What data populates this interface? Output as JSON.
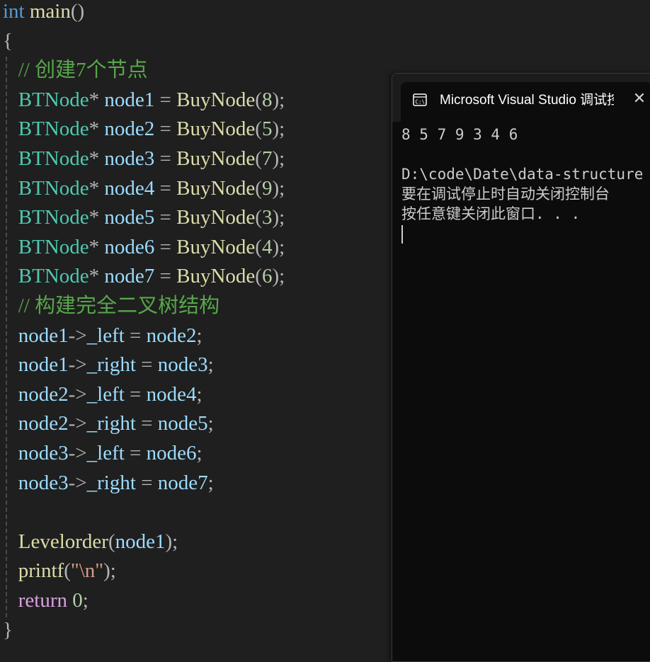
{
  "editor": {
    "lines": [
      [
        {
          "t": "int",
          "c": "kw"
        },
        {
          "t": " main",
          "c": "fn"
        },
        {
          "t": "()",
          "c": "pn"
        }
      ],
      [
        {
          "t": "{",
          "c": "pn"
        }
      ],
      [
        {
          "t": "   // 创建7个节点",
          "c": "cm"
        }
      ],
      [
        {
          "t": "   BTNode",
          "c": "type"
        },
        {
          "t": "* ",
          "c": "pn"
        },
        {
          "t": "node1",
          "c": "var"
        },
        {
          "t": " = ",
          "c": "pn"
        },
        {
          "t": "BuyNode",
          "c": "fn"
        },
        {
          "t": "(",
          "c": "pn"
        },
        {
          "t": "8",
          "c": "num"
        },
        {
          "t": ");",
          "c": "pn"
        }
      ],
      [
        {
          "t": "   BTNode",
          "c": "type"
        },
        {
          "t": "* ",
          "c": "pn"
        },
        {
          "t": "node2",
          "c": "var"
        },
        {
          "t": " = ",
          "c": "pn"
        },
        {
          "t": "BuyNode",
          "c": "fn"
        },
        {
          "t": "(",
          "c": "pn"
        },
        {
          "t": "5",
          "c": "num"
        },
        {
          "t": ");",
          "c": "pn"
        }
      ],
      [
        {
          "t": "   BTNode",
          "c": "type"
        },
        {
          "t": "* ",
          "c": "pn"
        },
        {
          "t": "node3",
          "c": "var"
        },
        {
          "t": " = ",
          "c": "pn"
        },
        {
          "t": "BuyNode",
          "c": "fn"
        },
        {
          "t": "(",
          "c": "pn"
        },
        {
          "t": "7",
          "c": "num"
        },
        {
          "t": ");",
          "c": "pn"
        }
      ],
      [
        {
          "t": "   BTNode",
          "c": "type"
        },
        {
          "t": "* ",
          "c": "pn"
        },
        {
          "t": "node4",
          "c": "var"
        },
        {
          "t": " = ",
          "c": "pn"
        },
        {
          "t": "BuyNode",
          "c": "fn"
        },
        {
          "t": "(",
          "c": "pn"
        },
        {
          "t": "9",
          "c": "num"
        },
        {
          "t": ");",
          "c": "pn"
        }
      ],
      [
        {
          "t": "   BTNode",
          "c": "type"
        },
        {
          "t": "* ",
          "c": "pn"
        },
        {
          "t": "node5",
          "c": "var"
        },
        {
          "t": " = ",
          "c": "pn"
        },
        {
          "t": "BuyNode",
          "c": "fn"
        },
        {
          "t": "(",
          "c": "pn"
        },
        {
          "t": "3",
          "c": "num"
        },
        {
          "t": ");",
          "c": "pn"
        }
      ],
      [
        {
          "t": "   BTNode",
          "c": "type"
        },
        {
          "t": "* ",
          "c": "pn"
        },
        {
          "t": "node6",
          "c": "var"
        },
        {
          "t": " = ",
          "c": "pn"
        },
        {
          "t": "BuyNode",
          "c": "fn"
        },
        {
          "t": "(",
          "c": "pn"
        },
        {
          "t": "4",
          "c": "num"
        },
        {
          "t": ");",
          "c": "pn"
        }
      ],
      [
        {
          "t": "   BTNode",
          "c": "type"
        },
        {
          "t": "* ",
          "c": "pn"
        },
        {
          "t": "node7",
          "c": "var"
        },
        {
          "t": " = ",
          "c": "pn"
        },
        {
          "t": "BuyNode",
          "c": "fn"
        },
        {
          "t": "(",
          "c": "pn"
        },
        {
          "t": "6",
          "c": "num"
        },
        {
          "t": ");",
          "c": "pn"
        }
      ],
      [
        {
          "t": "   // 构建完全二叉树结构",
          "c": "cm"
        }
      ],
      [
        {
          "t": "   node1",
          "c": "var"
        },
        {
          "t": "->",
          "c": "pn"
        },
        {
          "t": "_left",
          "c": "var"
        },
        {
          "t": " = ",
          "c": "pn"
        },
        {
          "t": "node2",
          "c": "var"
        },
        {
          "t": ";",
          "c": "pn"
        }
      ],
      [
        {
          "t": "   node1",
          "c": "var"
        },
        {
          "t": "->",
          "c": "pn"
        },
        {
          "t": "_right",
          "c": "var"
        },
        {
          "t": " = ",
          "c": "pn"
        },
        {
          "t": "node3",
          "c": "var"
        },
        {
          "t": ";",
          "c": "pn"
        }
      ],
      [
        {
          "t": "   node2",
          "c": "var"
        },
        {
          "t": "->",
          "c": "pn"
        },
        {
          "t": "_left",
          "c": "var"
        },
        {
          "t": " = ",
          "c": "pn"
        },
        {
          "t": "node4",
          "c": "var"
        },
        {
          "t": ";",
          "c": "pn"
        }
      ],
      [
        {
          "t": "   node2",
          "c": "var"
        },
        {
          "t": "->",
          "c": "pn"
        },
        {
          "t": "_right",
          "c": "var"
        },
        {
          "t": " = ",
          "c": "pn"
        },
        {
          "t": "node5",
          "c": "var"
        },
        {
          "t": ";",
          "c": "pn"
        }
      ],
      [
        {
          "t": "   node3",
          "c": "var"
        },
        {
          "t": "->",
          "c": "pn"
        },
        {
          "t": "_left",
          "c": "var"
        },
        {
          "t": " = ",
          "c": "pn"
        },
        {
          "t": "node6",
          "c": "var"
        },
        {
          "t": ";",
          "c": "pn"
        }
      ],
      [
        {
          "t": "   node3",
          "c": "var"
        },
        {
          "t": "->",
          "c": "pn"
        },
        {
          "t": "_right",
          "c": "var"
        },
        {
          "t": " = ",
          "c": "pn"
        },
        {
          "t": "node7",
          "c": "var"
        },
        {
          "t": ";",
          "c": "pn"
        }
      ],
      [],
      [
        {
          "t": "   Levelorder",
          "c": "fn"
        },
        {
          "t": "(",
          "c": "pn"
        },
        {
          "t": "node1",
          "c": "var"
        },
        {
          "t": ");",
          "c": "pn"
        }
      ],
      [
        {
          "t": "   printf",
          "c": "fn"
        },
        {
          "t": "(",
          "c": "pn"
        },
        {
          "t": "\"\\n\"",
          "c": "str"
        },
        {
          "t": ");",
          "c": "pn"
        }
      ],
      [
        {
          "t": "   return",
          "c": "kw2"
        },
        {
          "t": " ",
          "c": "pn"
        },
        {
          "t": "0",
          "c": "num"
        },
        {
          "t": ";",
          "c": "pn"
        }
      ],
      [
        {
          "t": "}",
          "c": "pn"
        }
      ]
    ]
  },
  "console": {
    "tab_title": "Microsoft Visual Studio 调试控制台",
    "tab_icon": "console-icon",
    "close_glyph": "✕",
    "lines": [
      "8 5 7 9 3 4 6",
      "",
      "D:\\code\\Date\\data-structure",
      "要在调试停止时自动关闭控制台",
      "按任意键关闭此窗口. . ."
    ]
  }
}
